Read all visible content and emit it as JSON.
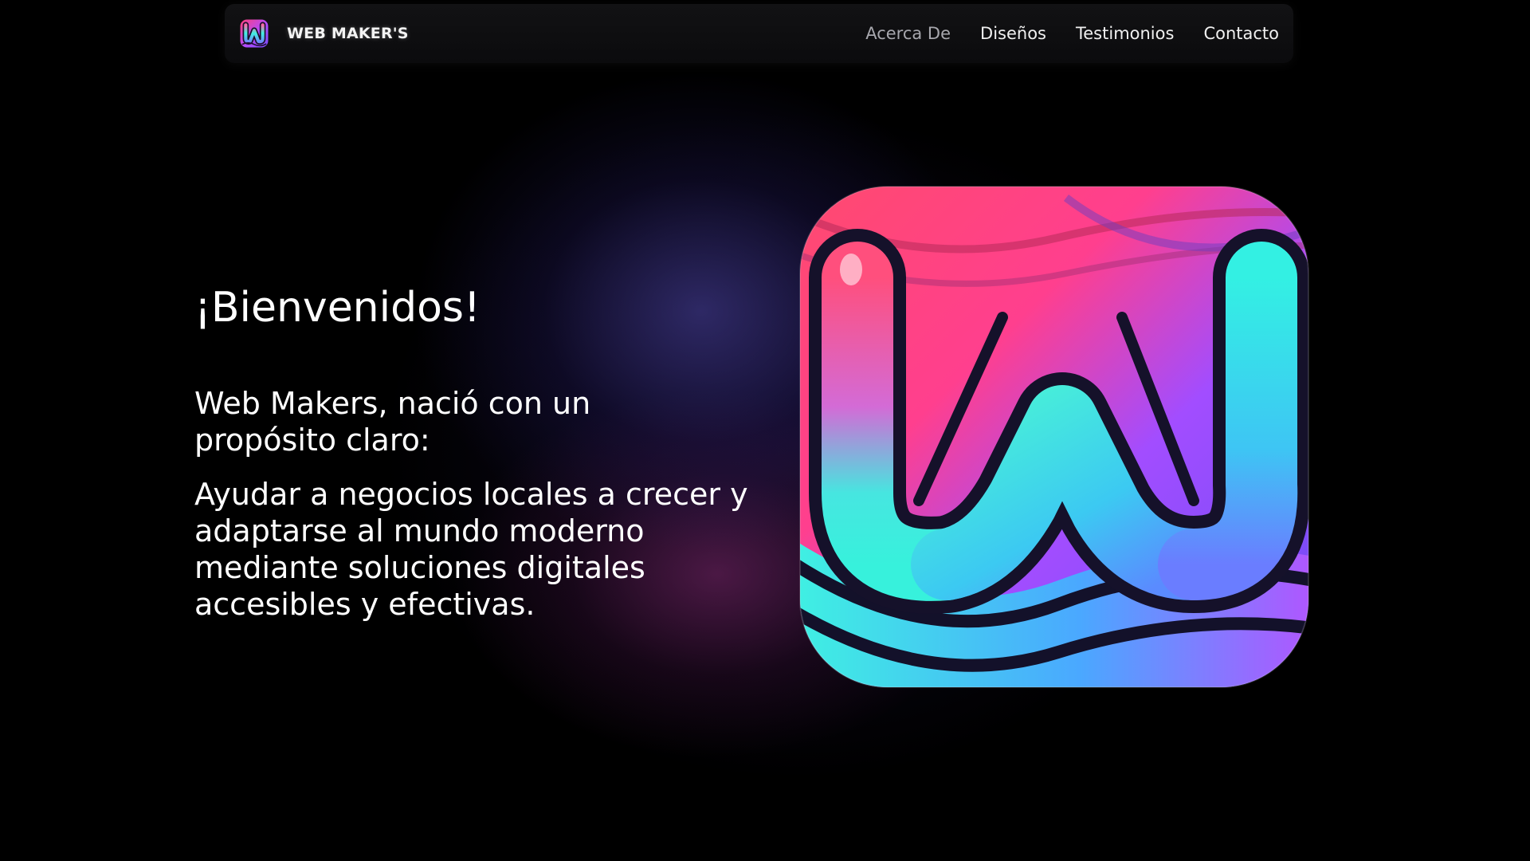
{
  "brand": {
    "name": "WEB MAKER'S",
    "logo_icon": "web-makers-w-logo"
  },
  "nav": {
    "items": [
      {
        "label": "Acerca De",
        "active": false
      },
      {
        "label": "Diseños",
        "active": false
      },
      {
        "label": "Testimonios",
        "active": false
      },
      {
        "label": "Contacto",
        "active": false
      }
    ]
  },
  "hero": {
    "title": "¡Bienvenidos!",
    "intro": "Web Makers, nació con un propósito claro:",
    "mission": "Ayudar a negocios locales a crecer y adaptarse al mundo moderno mediante soluciones digitales accesibles y efectivas.",
    "image_icon": "web-makers-app-icon"
  },
  "colors": {
    "background": "#000000",
    "navbar": "#0e0e10",
    "text": "#ffffff",
    "muted_link": "#a7a7ad",
    "logo_pink": "#ff3f7a",
    "logo_purple": "#9b4dff",
    "logo_cyan": "#35f3e0"
  }
}
